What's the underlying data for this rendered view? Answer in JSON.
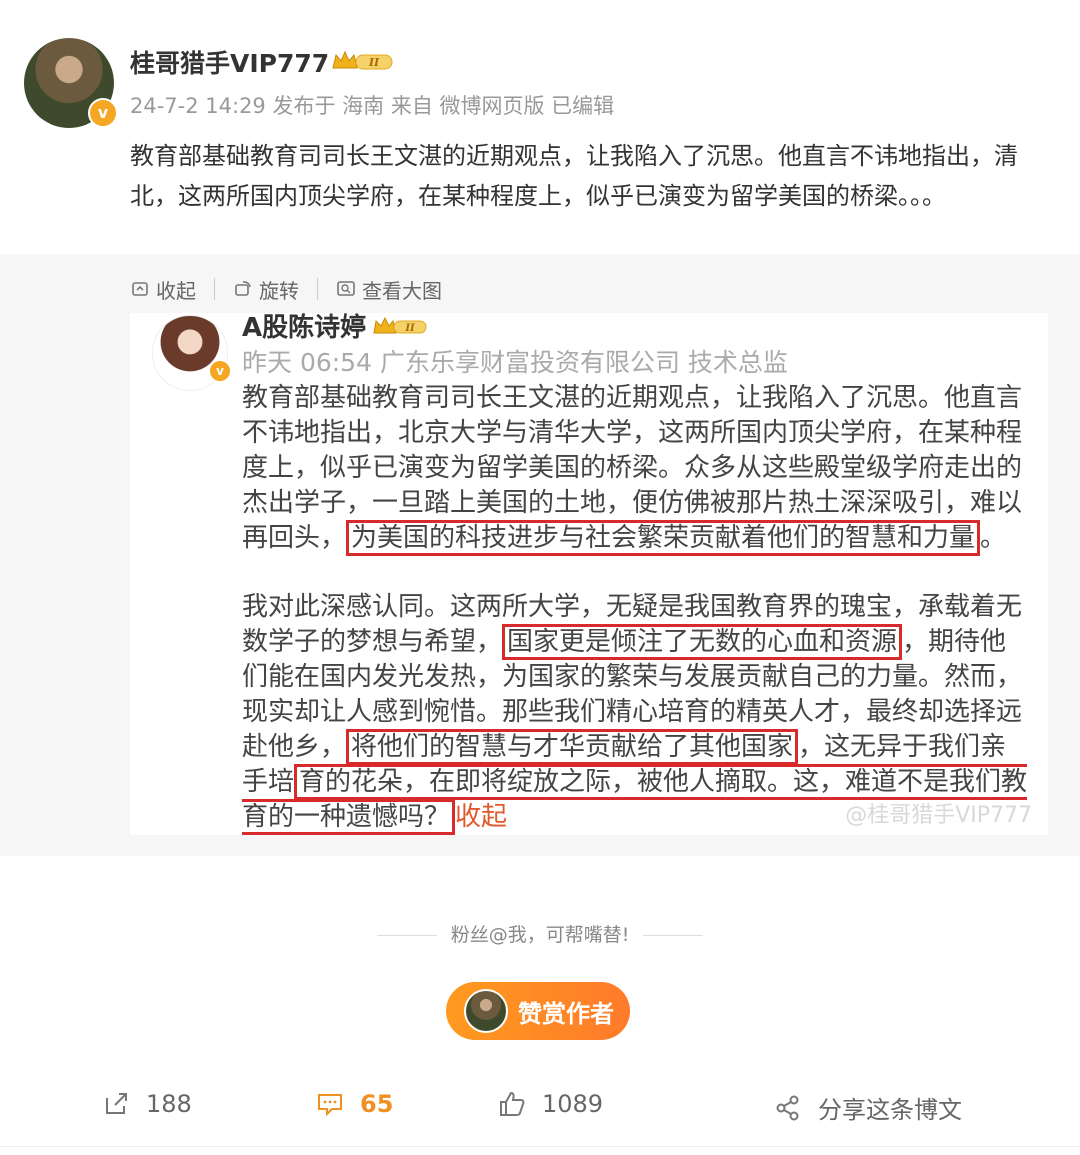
{
  "post": {
    "author": "桂哥猎手VIP777",
    "vip_level": "II",
    "avatar_badge": "v",
    "meta": "24-7-2 14:29 发布于 海南 来自 微博网页版 已编辑",
    "text": "教育部基础教育司司长王文湛的近期观点，让我陷入了沉思。他直言不讳地指出，清北，这两所国内顶尖学府，在某种程度上，似乎已演变为留学美国的桥梁。。。"
  },
  "gallery_tools": {
    "collapse": "收起",
    "rotate": "旋转",
    "view_large": "查看大图"
  },
  "screenshot": {
    "author": "A股陈诗婷",
    "vip_level": "II",
    "meta": "昨天 06:54 广东乐享财富投资有限公司 技术总监",
    "p1_before": "教育部基础教育司司长王文湛的近期观点，让我陷入了沉思。他直言不讳地指出，北京大学与清华大学，这两所国内顶尖学府，在某种程度上，似乎已演变为留学美国的桥梁。众多从这些殿堂级学府走出的杰出学子，一旦踏上美国的土地，便仿佛被那片热土深深吸引，难以再回头，",
    "p1_hl": "为美国的科技进步与社会繁荣贡献着他们的智慧和力量",
    "p1_after": "。",
    "p2_a": "我对此深感认同。这两所大学，无疑是我国教育界的瑰宝，承载着无数学子的梦想与希望，",
    "p2_hl1": "国家更是倾注了无数的心血和资源",
    "p2_b": "，期待他们能在国内发光发热，为国家的繁荣与发展贡献自己的力量。然而，现实却让人感到惋惜。那些我们精心培育的精英人才，最终却选择远赴他乡，",
    "p2_hl2": "将他们的智慧与才华贡献给了其他国家",
    "p2_c": "，这无异于我们亲手培",
    "p2_hl3": "育的花朵，在即将绽放之际，被他人摘取。这，难道不是我们教育的一种遗憾吗？",
    "collapse_link": "收起",
    "watermark": "@桂哥猎手VIP777"
  },
  "fans_prompt": "粉丝@我，可帮嘴替!",
  "reward_button": "赞赏作者",
  "actions": {
    "reposts": "188",
    "comments": "65",
    "likes": "1089",
    "share": "分享这条博文"
  },
  "colors": {
    "accent": "#f09020",
    "highlight_box": "#d82a2a",
    "reward_gradient_start": "#ff9a1f",
    "reward_gradient_end": "#ff7a2a"
  }
}
